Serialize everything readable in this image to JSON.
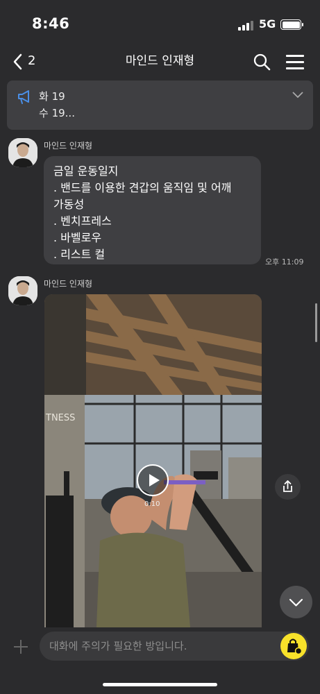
{
  "status_bar": {
    "time": "8:46",
    "network": "5G"
  },
  "header": {
    "back_count": "2",
    "title": "마인드 인재형"
  },
  "notice": {
    "line1": "화 19",
    "line2": "수 19..."
  },
  "messages": [
    {
      "sender": "마인드 인재형",
      "lines": [
        "금일 운동일지",
        ". 밴드를 이용한 견갑의 움직임 및 어깨",
        "가동성",
        ". 벤치프레스",
        ". 바벨로우",
        ". 리스트 컬"
      ],
      "time": "오후 11:09"
    },
    {
      "sender": "마인드 인재형",
      "video": {
        "duration": "0:10",
        "overlay_text": "TNESS"
      }
    }
  ],
  "composer": {
    "placeholder": "대화에 주의가 필요한 방입니다."
  },
  "colors": {
    "background": "#2b2b2d",
    "bubble": "#3f3f42",
    "accent_yellow": "#f7e12a"
  },
  "icons": [
    "back-icon",
    "search-icon",
    "menu-icon",
    "megaphone-icon",
    "chevron-down-icon",
    "play-icon",
    "share-icon",
    "plus-icon",
    "shopping-bag-icon"
  ]
}
